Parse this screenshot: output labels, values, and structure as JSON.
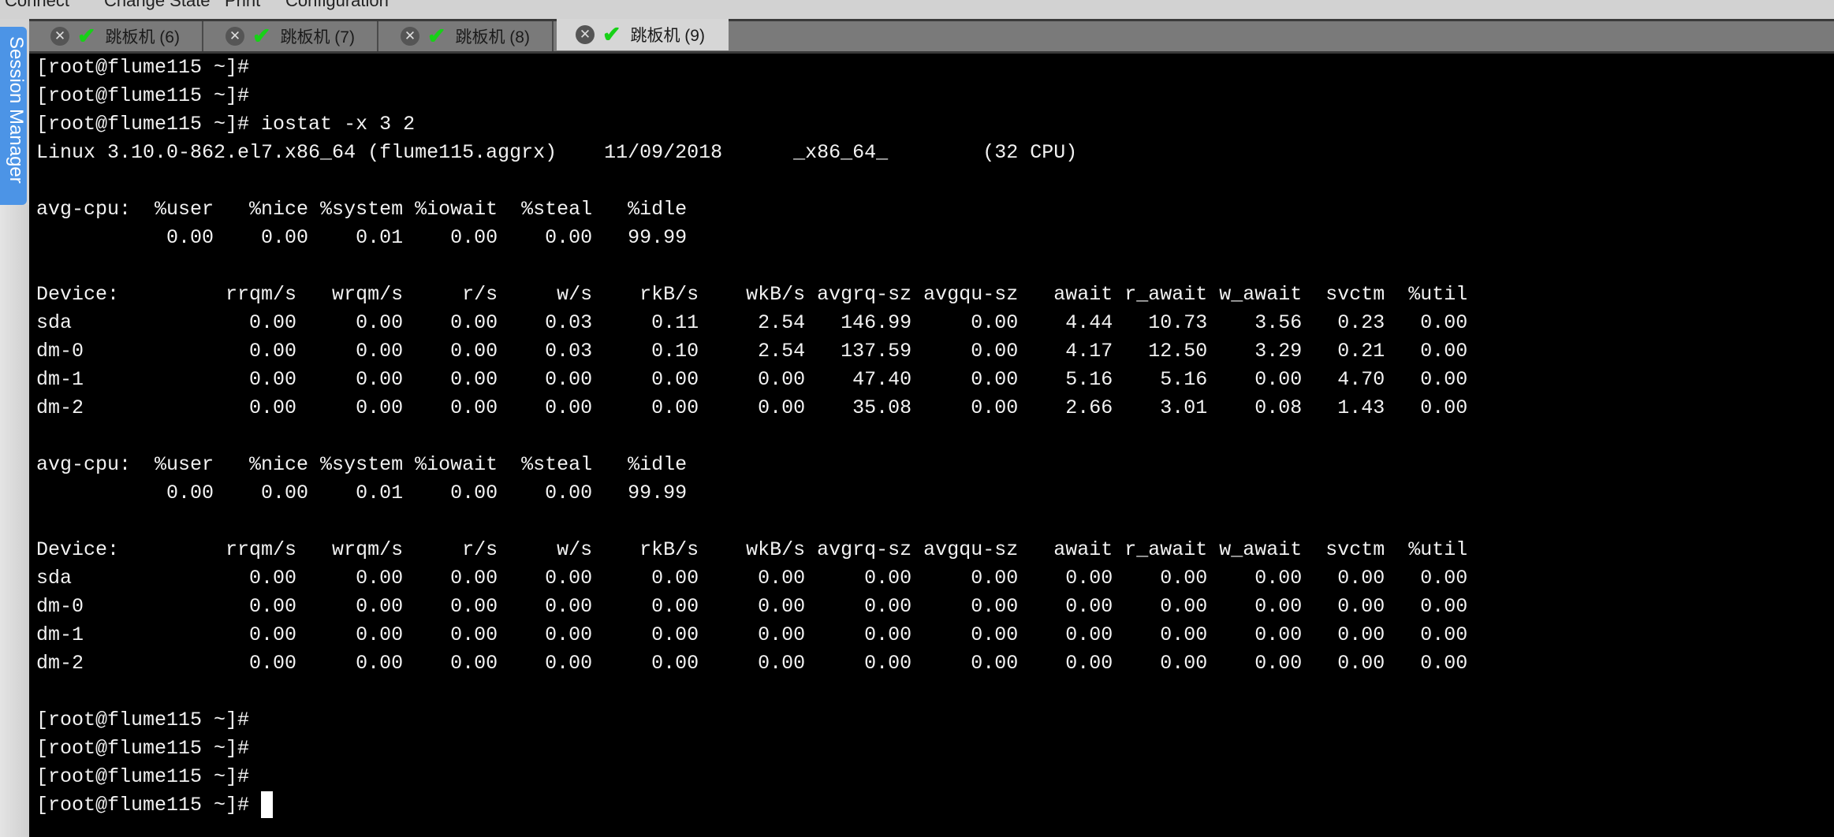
{
  "menu": [
    "Connect",
    "Change State",
    "Print",
    "Configuration"
  ],
  "tabs": [
    {
      "label": "跳板机 (6)",
      "active": false
    },
    {
      "label": "跳板机 (7)",
      "active": false
    },
    {
      "label": "跳板机 (8)",
      "active": false
    },
    {
      "label": "跳板机 (9)",
      "active": true
    }
  ],
  "session_manager": "Session Manager",
  "colors": {
    "session_tab": "#4c94e6",
    "check": "#17d117",
    "terminal_bg": "#000000"
  },
  "terminal": {
    "lines": [
      "[root@flume115 ~]#",
      "[root@flume115 ~]#",
      "[root@flume115 ~]# iostat -x 3 2",
      "Linux 3.10.0-862.el7.x86_64 (flume115.aggrx)    11/09/2018      _x86_64_        (32 CPU)",
      "",
      "avg-cpu:  %user   %nice %system %iowait  %steal   %idle",
      "           0.00    0.00    0.01    0.00    0.00   99.99",
      "",
      "Device:         rrqm/s   wrqm/s     r/s     w/s    rkB/s    wkB/s avgrq-sz avgqu-sz   await r_await w_await  svctm  %util",
      "sda               0.00     0.00    0.00    0.03     0.11     2.54   146.99     0.00    4.44   10.73    3.56   0.23   0.00",
      "dm-0              0.00     0.00    0.00    0.03     0.10     2.54   137.59     0.00    4.17   12.50    3.29   0.21   0.00",
      "dm-1              0.00     0.00    0.00    0.00     0.00     0.00    47.40     0.00    5.16    5.16    0.00   4.70   0.00",
      "dm-2              0.00     0.00    0.00    0.00     0.00     0.00    35.08     0.00    2.66    3.01    0.08   1.43   0.00",
      "",
      "avg-cpu:  %user   %nice %system %iowait  %steal   %idle",
      "           0.00    0.00    0.01    0.00    0.00   99.99",
      "",
      "Device:         rrqm/s   wrqm/s     r/s     w/s    rkB/s    wkB/s avgrq-sz avgqu-sz   await r_await w_await  svctm  %util",
      "sda               0.00     0.00    0.00    0.00     0.00     0.00     0.00     0.00    0.00    0.00    0.00   0.00   0.00",
      "dm-0              0.00     0.00    0.00    0.00     0.00     0.00     0.00     0.00    0.00    0.00    0.00   0.00   0.00",
      "dm-1              0.00     0.00    0.00    0.00     0.00     0.00     0.00     0.00    0.00    0.00    0.00   0.00   0.00",
      "dm-2              0.00     0.00    0.00    0.00     0.00     0.00     0.00     0.00    0.00    0.00    0.00   0.00   0.00",
      "",
      "[root@flume115 ~]#",
      "[root@flume115 ~]#",
      "[root@flume115 ~]#",
      "[root@flume115 ~]#"
    ]
  }
}
